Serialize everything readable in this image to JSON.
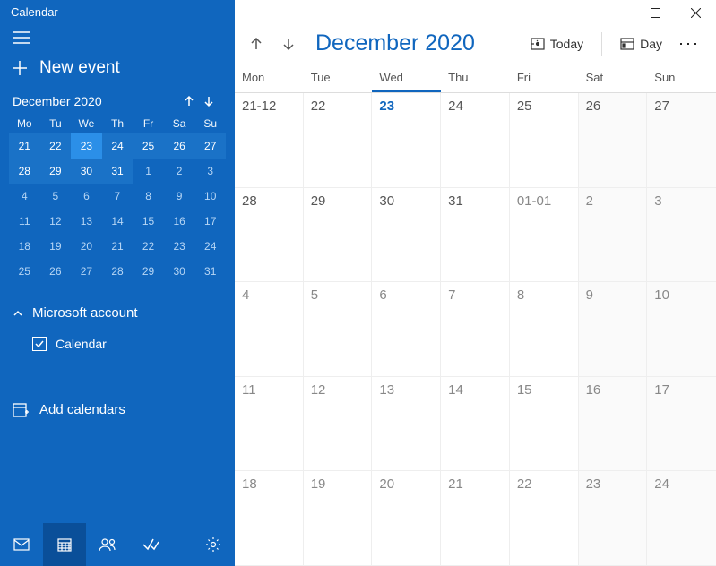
{
  "app_title": "Calendar",
  "new_event_label": "New event",
  "mini_calendar": {
    "title": "December 2020",
    "day_headers": [
      "Mo",
      "Tu",
      "We",
      "Th",
      "Fr",
      "Sa",
      "Su"
    ],
    "weeks": [
      [
        {
          "d": "21",
          "in": true
        },
        {
          "d": "22",
          "in": true
        },
        {
          "d": "23",
          "in": true,
          "sel": true
        },
        {
          "d": "24",
          "in": true
        },
        {
          "d": "25",
          "in": true
        },
        {
          "d": "26",
          "in": true
        },
        {
          "d": "27",
          "in": true
        }
      ],
      [
        {
          "d": "28",
          "in": true
        },
        {
          "d": "29",
          "in": true
        },
        {
          "d": "30",
          "in": true
        },
        {
          "d": "31",
          "in": true
        },
        {
          "d": "1"
        },
        {
          "d": "2"
        },
        {
          "d": "3"
        }
      ],
      [
        {
          "d": "4"
        },
        {
          "d": "5"
        },
        {
          "d": "6"
        },
        {
          "d": "7"
        },
        {
          "d": "8"
        },
        {
          "d": "9"
        },
        {
          "d": "10"
        }
      ],
      [
        {
          "d": "11"
        },
        {
          "d": "12"
        },
        {
          "d": "13"
        },
        {
          "d": "14"
        },
        {
          "d": "15"
        },
        {
          "d": "16"
        },
        {
          "d": "17"
        }
      ],
      [
        {
          "d": "18"
        },
        {
          "d": "19"
        },
        {
          "d": "20"
        },
        {
          "d": "21"
        },
        {
          "d": "22"
        },
        {
          "d": "23"
        },
        {
          "d": "24"
        }
      ],
      [
        {
          "d": "25"
        },
        {
          "d": "26"
        },
        {
          "d": "27"
        },
        {
          "d": "28"
        },
        {
          "d": "29"
        },
        {
          "d": "30"
        },
        {
          "d": "31"
        }
      ]
    ]
  },
  "account_label": "Microsoft account",
  "calendar_item_label": "Calendar",
  "add_calendars_label": "Add calendars",
  "toolbar": {
    "month_title": "December 2020",
    "today_label": "Today",
    "view_label": "Day"
  },
  "main_day_headers": [
    "Mon",
    "Tue",
    "Wed",
    "Thu",
    "Fri",
    "Sat",
    "Sun"
  ],
  "main_selected_header_index": 2,
  "main_weeks": [
    [
      {
        "d": "21-12"
      },
      {
        "d": "22"
      },
      {
        "d": "23",
        "sel": true
      },
      {
        "d": "24"
      },
      {
        "d": "25"
      },
      {
        "d": "26",
        "wk": true
      },
      {
        "d": "27",
        "wk": true
      }
    ],
    [
      {
        "d": "28"
      },
      {
        "d": "29"
      },
      {
        "d": "30"
      },
      {
        "d": "31"
      },
      {
        "d": "01-01",
        "other": true
      },
      {
        "d": "2",
        "other": true,
        "wk": true
      },
      {
        "d": "3",
        "other": true,
        "wk": true
      }
    ],
    [
      {
        "d": "4",
        "other": true
      },
      {
        "d": "5",
        "other": true
      },
      {
        "d": "6",
        "other": true
      },
      {
        "d": "7",
        "other": true
      },
      {
        "d": "8",
        "other": true
      },
      {
        "d": "9",
        "other": true,
        "wk": true
      },
      {
        "d": "10",
        "other": true,
        "wk": true
      }
    ],
    [
      {
        "d": "11",
        "other": true
      },
      {
        "d": "12",
        "other": true
      },
      {
        "d": "13",
        "other": true
      },
      {
        "d": "14",
        "other": true
      },
      {
        "d": "15",
        "other": true
      },
      {
        "d": "16",
        "other": true,
        "wk": true
      },
      {
        "d": "17",
        "other": true,
        "wk": true
      }
    ],
    [
      {
        "d": "18",
        "other": true
      },
      {
        "d": "19",
        "other": true
      },
      {
        "d": "20",
        "other": true
      },
      {
        "d": "21",
        "other": true
      },
      {
        "d": "22",
        "other": true
      },
      {
        "d": "23",
        "other": true,
        "wk": true
      },
      {
        "d": "24",
        "other": true,
        "wk": true
      }
    ]
  ]
}
